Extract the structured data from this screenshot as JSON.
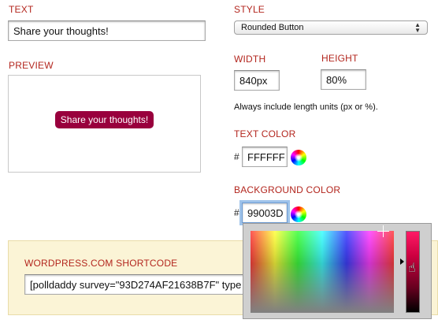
{
  "text_section": {
    "label": "TEXT",
    "value": "Share your thoughts!"
  },
  "preview_section": {
    "label": "PREVIEW",
    "button_text": "Share your thoughts!",
    "button_color": "#99003D"
  },
  "style_section": {
    "label": "STYLE",
    "selected": "Rounded Button"
  },
  "width_section": {
    "label": "WIDTH",
    "value": "840px"
  },
  "height_section": {
    "label": "HEIGHT",
    "value": "80%"
  },
  "units_hint": "Always include length units (px or %).",
  "text_color_section": {
    "label": "TEXT COLOR",
    "hash": "#",
    "value": "FFFFFF"
  },
  "background_color_section": {
    "label": "BACKGROUND COLOR",
    "hash": "#",
    "value": "99003D"
  },
  "shortcode_section": {
    "label": "WORDPRESS.COM SHORTCODE",
    "value": "[polldaddy survey=\"93D274AF21638B7F\" type"
  },
  "color_picker": {
    "open": true,
    "icons": [
      "crosshair-icon",
      "slider-arrow-icon",
      "hand-cursor-icon"
    ]
  },
  "colors": {
    "label_red": "#b3261e",
    "panel_bg": "#fbf4d6"
  }
}
